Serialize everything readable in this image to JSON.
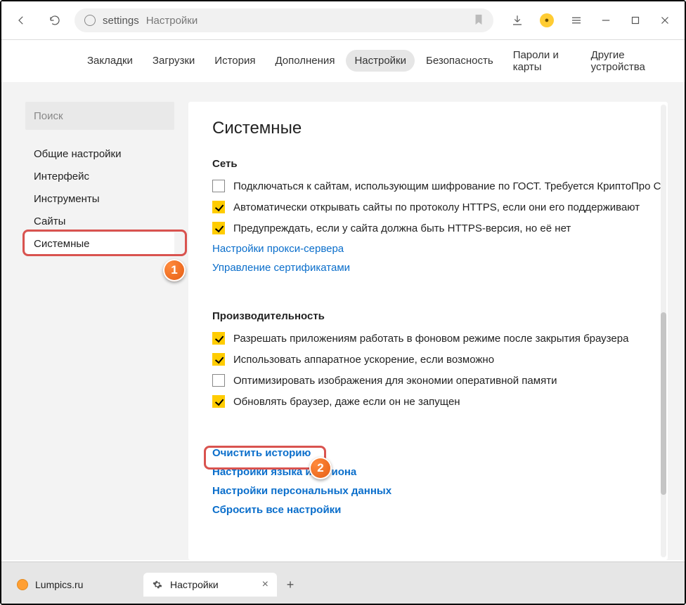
{
  "toolbar": {
    "address_scheme": "settings",
    "address_title": "Настройки"
  },
  "nav": {
    "tabs": [
      {
        "label": "Закладки"
      },
      {
        "label": "Загрузки"
      },
      {
        "label": "История"
      },
      {
        "label": "Дополнения"
      },
      {
        "label": "Настройки"
      },
      {
        "label": "Безопасность"
      },
      {
        "label": "Пароли и карты"
      },
      {
        "label": "Другие устройства"
      }
    ],
    "active_index": 4
  },
  "sidebar": {
    "search_placeholder": "Поиск",
    "items": [
      {
        "label": "Общие настройки"
      },
      {
        "label": "Интерфейс"
      },
      {
        "label": "Инструменты"
      },
      {
        "label": "Сайты"
      },
      {
        "label": "Системные"
      }
    ],
    "active_index": 4
  },
  "page": {
    "title": "Системные",
    "sections": {
      "network": {
        "title": "Сеть",
        "items": [
          {
            "checked": false,
            "label": "Подключаться к сайтам, использующим шифрование по ГОСТ. Требуется КриптоПро C"
          },
          {
            "checked": true,
            "label": "Автоматически открывать сайты по протоколу HTTPS, если они его поддерживают"
          },
          {
            "checked": true,
            "label": "Предупреждать, если у сайта должна быть HTTPS-версия, но её нет"
          }
        ],
        "links": [
          "Настройки прокси-сервера",
          "Управление сертификатами"
        ]
      },
      "performance": {
        "title": "Производительность",
        "items": [
          {
            "checked": true,
            "label": "Разрешать приложениям работать в фоновом режиме после закрытия браузера"
          },
          {
            "checked": true,
            "label": "Использовать аппаратное ускорение, если возможно"
          },
          {
            "checked": false,
            "label": "Оптимизировать изображения для экономии оперативной памяти"
          },
          {
            "checked": true,
            "label": "Обновлять браузер, даже если он не запущен"
          }
        ]
      },
      "bottom_links": [
        "Очистить историю",
        "Настройки языка и региона",
        "Настройки персональных данных",
        "Сбросить все настройки"
      ]
    }
  },
  "annotations": {
    "badge1": "1",
    "badge2": "2"
  },
  "tabs_bottom": {
    "tabs": [
      {
        "label": "Lumpics.ru"
      },
      {
        "label": "Настройки"
      }
    ],
    "active_index": 1
  }
}
